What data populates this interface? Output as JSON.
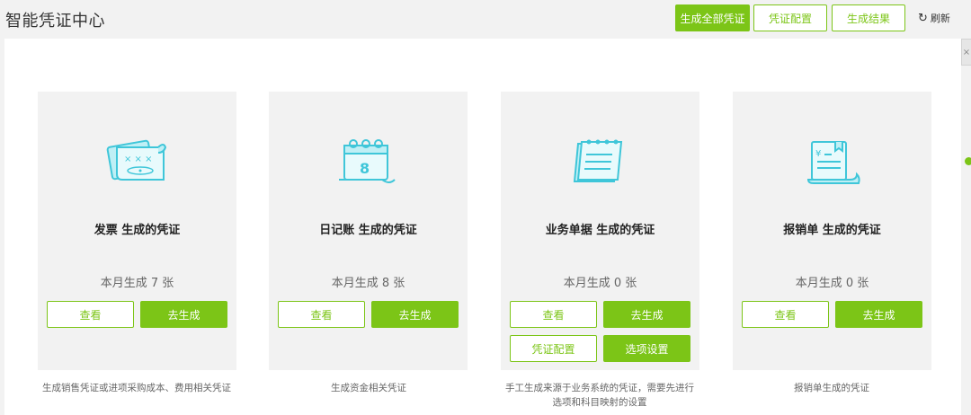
{
  "header": {
    "title": "智能凭证中心",
    "generate_all_label": "生成全部凭证",
    "config_label": "凭证配置",
    "results_label": "生成结果",
    "refresh_label": "刷新"
  },
  "cards": [
    {
      "title": "发票 生成的凭证",
      "count": "本月生成 7 张",
      "view_label": "查看",
      "generate_label": "去生成",
      "description": "生成销售凭证或进项采购成本、费用相关凭证"
    },
    {
      "title": "日记账 生成的凭证",
      "count": "本月生成 8 张",
      "view_label": "查看",
      "generate_label": "去生成",
      "description": "生成资金相关凭证"
    },
    {
      "title": "业务单据 生成的凭证",
      "count": "本月生成 0 张",
      "view_label": "查看",
      "generate_label": "去生成",
      "config_label": "凭证配置",
      "options_label": "选项设置",
      "description_line1": "手工生成来源于业务系统的凭证，需要先进行",
      "description_line2": "选项和科目映射的设置"
    },
    {
      "title": "报销单 生成的凭证",
      "count": "本月生成 0 张",
      "view_label": "查看",
      "generate_label": "去生成",
      "description": "报销单生成的凭证"
    }
  ],
  "icons": [
    "invoice-icon",
    "journal-calendar-icon",
    "business-document-icon",
    "expense-report-icon"
  ],
  "colors": {
    "accent": "#7cc517",
    "icon": "#3fc6d9",
    "icon_fill": "#bfeff5"
  }
}
